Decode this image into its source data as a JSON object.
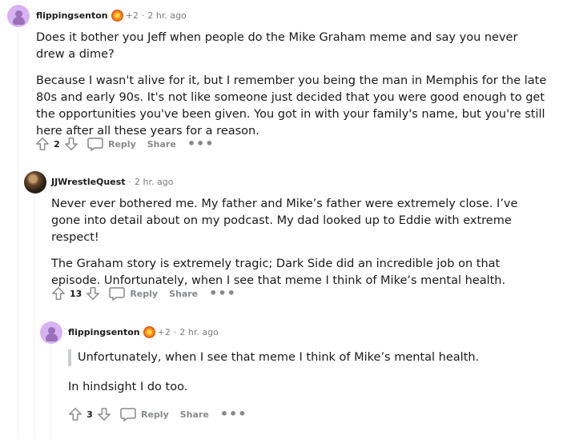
{
  "comments": [
    {
      "username": "flippingsenton",
      "karma": "+2",
      "time": "2 hr. ago",
      "paragraphs": [
        "Does it bother you Jeff when people do the Mike Graham meme and say you never drew a dime?",
        "Because I wasn't alive for it, but I remember you being the man in Memphis for the late 80s and early 90s. It's not like someone just decided that you were good enough to get the opportunities you've been given. You got in with your family's name, but you're still here after all these years for a reason."
      ],
      "votes": "2",
      "reply_label": "Reply",
      "share_label": "Share",
      "more_label": "•••"
    },
    {
      "username": "JJWrestleQuest",
      "time": "2 hr. ago",
      "paragraphs": [
        "Never ever bothered me. My father and Mike’s father were extremely close. I’ve gone into detail about on my podcast. My dad looked up to Eddie with extreme respect!",
        "The Graham story is extremely tragic; Dark Side did an incredible job on that episode. Unfortunately, when I see that meme I think of Mike’s mental health."
      ],
      "votes": "13",
      "reply_label": "Reply",
      "share_label": "Share",
      "more_label": "•••"
    },
    {
      "username": "flippingsenton",
      "karma": "+2",
      "time": "2 hr. ago",
      "quote": "Unfortunately, when I see that meme I think of Mike’s mental health.",
      "paragraphs": [
        "In hindsight I do too."
      ],
      "votes": "3",
      "reply_label": "Reply",
      "share_label": "Share",
      "more_label": "•••"
    }
  ],
  "separator": "·",
  "icons": {
    "avatar_default": "snoo-avatar-icon",
    "flair": "achievement-flair-icon",
    "upvote": "upvote-arrow-icon",
    "downvote": "downvote-arrow-icon",
    "reply": "speech-bubble-icon"
  }
}
